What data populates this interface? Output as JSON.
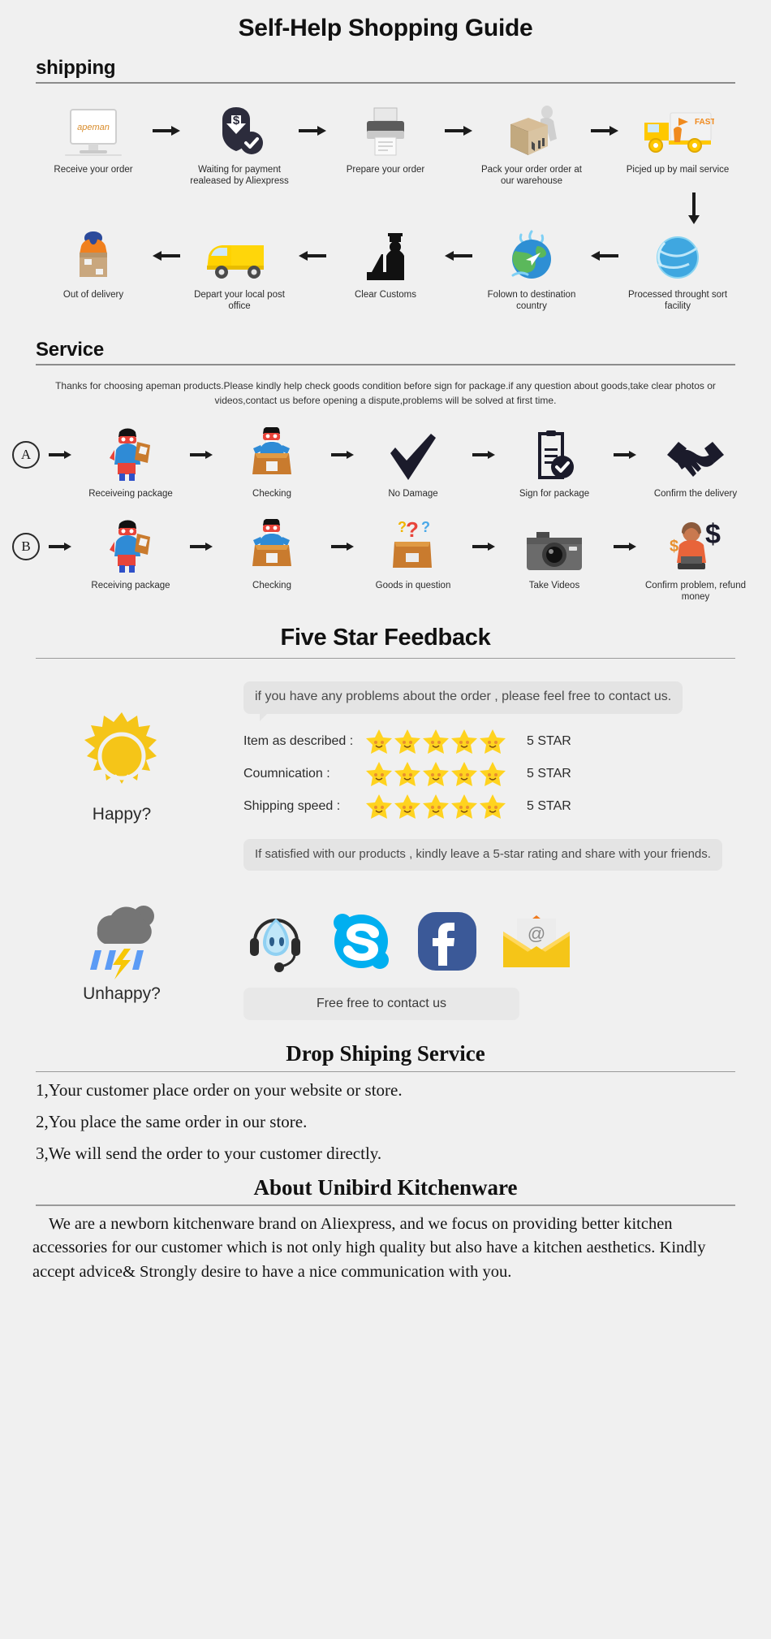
{
  "title": "Self-Help Shopping Guide",
  "shipping": {
    "heading": "shipping",
    "row1": [
      {
        "caption": "Receive your order",
        "icon": "monitor-apeman-icon"
      },
      {
        "caption": "Waiting for payment realeased by Aliexpress",
        "icon": "payment-shield-icon"
      },
      {
        "caption": "Prepare your order",
        "icon": "printer-icon"
      },
      {
        "caption": "Pack your order order at our warehouse",
        "icon": "packing-box-icon"
      },
      {
        "caption": "Picjed up by mail service",
        "icon": "delivery-truck-fast-icon"
      }
    ],
    "row2": [
      {
        "caption": "Out of delivery",
        "icon": "courier-box-icon"
      },
      {
        "caption": "Depart your local post office",
        "icon": "yellow-van-icon"
      },
      {
        "caption": "Clear Customs",
        "icon": "customs-officer-icon"
      },
      {
        "caption": "Folown to destination country",
        "icon": "globe-airplane-icon"
      },
      {
        "caption": "Processed throught sort facility",
        "icon": "blue-globe-icon"
      }
    ],
    "arrow_glyph": "→",
    "arrow_left_glyph": "←",
    "arrow_down_glyph": "↓"
  },
  "service": {
    "heading": "Service",
    "blurb": "Thanks for choosing apeman products.Please kindly help check goods condition before sign for package.if any question about goods,take clear photos or videos,contact us before opening a dispute,problems will be solved at first time.",
    "rowA": {
      "badge": "A",
      "steps": [
        {
          "caption": "Receiveing package",
          "icon": "hero-holding-package-icon"
        },
        {
          "caption": "Checking",
          "icon": "hero-opening-box-icon"
        },
        {
          "caption": "No Damage",
          "icon": "checkmark-icon"
        },
        {
          "caption": "Sign for package",
          "icon": "signed-document-icon"
        },
        {
          "caption": "Confirm the delivery",
          "icon": "handshake-icon"
        }
      ]
    },
    "rowB": {
      "badge": "B",
      "steps": [
        {
          "caption": "Receiving package",
          "icon": "hero-holding-package-icon"
        },
        {
          "caption": "Checking",
          "icon": "hero-opening-box-icon"
        },
        {
          "caption": "Goods in question",
          "icon": "question-box-icon"
        },
        {
          "caption": "Take Videos",
          "icon": "camera-icon"
        },
        {
          "caption": "Confirm problem, refund money",
          "icon": "refund-agent-icon"
        }
      ]
    }
  },
  "feedback": {
    "title": "Five Star Feedback",
    "happy_label": "Happy?",
    "unhappy_label": "Unhappy?",
    "bubble": "if you have any problems about the order , please feel free to contact us.",
    "ratings": [
      {
        "label": "Item as described :",
        "stars": 5,
        "value": "5 STAR"
      },
      {
        "label": "Coumnication :",
        "stars": 5,
        "value": "5 STAR"
      },
      {
        "label": "Shipping speed :",
        "stars": 5,
        "value": "5 STAR"
      }
    ],
    "note": "If satisfied with our products ,  kindly leave a 5-star rating and share with your friends.",
    "contact_button": "Free free to contact us",
    "contact_icons": [
      {
        "name": "trademanager-headset-icon"
      },
      {
        "name": "skype-icon"
      },
      {
        "name": "facebook-icon"
      },
      {
        "name": "email-envelope-icon"
      }
    ],
    "colors": {
      "sun": "#F5C518",
      "cloud": "#757575",
      "rain_blue": "#5B9BF5",
      "lightning_yellow": "#F7C707",
      "skype": "#00AFF0",
      "facebook": "#3B5998",
      "envelope": "#F5C518",
      "star": "#FFD31F"
    }
  },
  "dropshipping": {
    "title": "Drop Shiping Service",
    "items": [
      "1,Your customer place order on your website or store.",
      "2,You place the same order in our store.",
      "3,We will send the order to your customer directly."
    ]
  },
  "about": {
    "title": "About Unibird Kitchenware",
    "body": "We are a newborn kitchenware brand on Aliexpress, and we focus on providing better kitchen accessories for our customer which is not only high quality but also have a kitchen aesthetics. Kindly accept advice& Strongly desire to have a nice communication with you."
  }
}
